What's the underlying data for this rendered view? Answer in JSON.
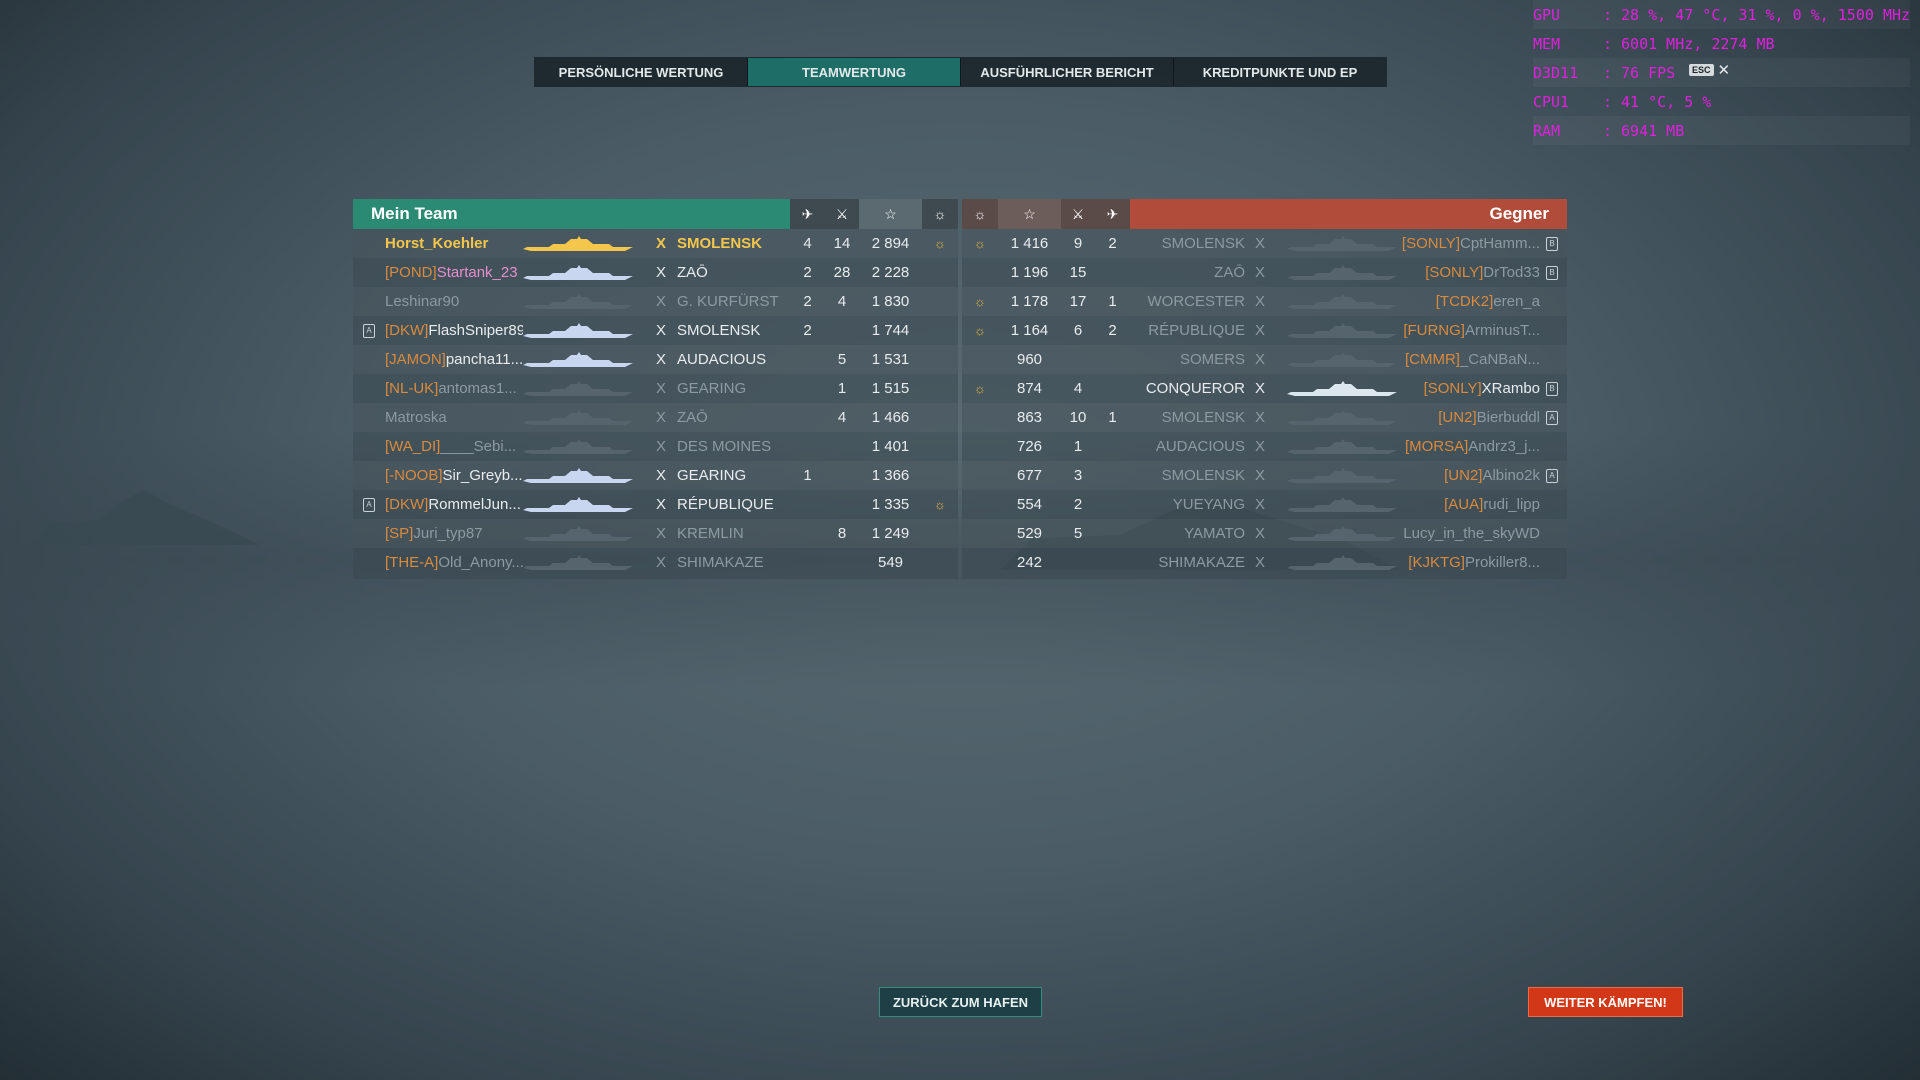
{
  "hud": [
    {
      "k": "GPU",
      "v": ": 28 %, 47 °C, 31 %, 0 %, 1500 MHz"
    },
    {
      "k": "MEM",
      "v": ": 6001 MHz, 2274 MB"
    },
    {
      "k": "D3D11",
      "v": ": 76 FPS"
    },
    {
      "k": "CPU1",
      "v": ": 41 °C, 5 %"
    },
    {
      "k": "RAM",
      "v": ": 6941 MB"
    }
  ],
  "tabs": [
    "PERSÖNLICHE WERTUNG",
    "TEAMWERTUNG",
    "AUSFÜHRLICHER BERICHT",
    "KREDITPUNKTE UND EP"
  ],
  "esc": {
    "key": "ESC",
    "close": "✕"
  },
  "my_team": {
    "title": "Mein Team",
    "rows": [
      {
        "clan": "",
        "name": "Horst_Koehler",
        "style": "me",
        "x": "X",
        "ship": "SMOLENSK",
        "planes": "4",
        "kills": "14",
        "exp": "2 894",
        "medal": true,
        "badge": ""
      },
      {
        "clan": "[POND]",
        "name": "Startank_23",
        "style": "pink",
        "x": "X",
        "ship": "ZAŌ",
        "planes": "2",
        "kills": "28",
        "exp": "2 228",
        "medal": false,
        "badge": ""
      },
      {
        "clan": "",
        "name": "Leshinar90",
        "style": "dim",
        "x": "X",
        "ship": "G. KURFÜRST",
        "planes": "2",
        "kills": "4",
        "exp": "1 830",
        "medal": false,
        "badge": ""
      },
      {
        "clan": "[DKW]",
        "name": "FlashSniper89",
        "style": "",
        "x": "X",
        "ship": "SMOLENSK",
        "planes": "2",
        "kills": "",
        "exp": "1 744",
        "medal": false,
        "badge": "A"
      },
      {
        "clan": "[JAMON]",
        "name": "pancha11...",
        "style": "",
        "x": "X",
        "ship": "AUDACIOUS",
        "planes": "",
        "kills": "5",
        "exp": "1 531",
        "medal": false,
        "badge": ""
      },
      {
        "clan": "[NL-UK]",
        "name": "antomas1...",
        "style": "dim",
        "x": "X",
        "ship": "GEARING",
        "planes": "",
        "kills": "1",
        "exp": "1 515",
        "medal": false,
        "badge": ""
      },
      {
        "clan": "",
        "name": "Matroska",
        "style": "dim",
        "x": "X",
        "ship": "ZAŌ",
        "planes": "",
        "kills": "4",
        "exp": "1 466",
        "medal": false,
        "badge": ""
      },
      {
        "clan": "[WA_DI]",
        "name": "____Sebi...",
        "style": "dim",
        "x": "X",
        "ship": "DES MOINES",
        "planes": "",
        "kills": "",
        "exp": "1 401",
        "medal": false,
        "badge": ""
      },
      {
        "clan": "[-NOOB]",
        "name": "Sir_Greyb...",
        "style": "",
        "x": "X",
        "ship": "GEARING",
        "planes": "1",
        "kills": "",
        "exp": "1 366",
        "medal": false,
        "badge": ""
      },
      {
        "clan": "[DKW]",
        "name": "RommelJun...",
        "style": "",
        "x": "X",
        "ship": "RÉPUBLIQUE",
        "planes": "",
        "kills": "",
        "exp": "1 335",
        "medal": true,
        "badge": "A"
      },
      {
        "clan": "[SP]",
        "name": "Juri_typ87",
        "style": "dim",
        "x": "X",
        "ship": "KREMLIN",
        "planes": "",
        "kills": "8",
        "exp": "1 249",
        "medal": false,
        "badge": ""
      },
      {
        "clan": "[THE-A]",
        "name": "Old_Anony...",
        "style": "dim",
        "x": "X",
        "ship": "SHIMAKAZE",
        "planes": "",
        "kills": "",
        "exp": "549",
        "medal": false,
        "badge": ""
      }
    ]
  },
  "enemy": {
    "title": "Gegner",
    "rows": [
      {
        "medal": true,
        "exp": "1 416",
        "kills": "9",
        "planes": "2",
        "ship": "SMOLENSK",
        "x": "X",
        "clan": "[SONLY]",
        "name": "CptHamm...",
        "style": "dim",
        "badge": "B"
      },
      {
        "medal": false,
        "exp": "1 196",
        "kills": "15",
        "planes": "",
        "ship": "ZAŌ",
        "x": "X",
        "clan": "[SONLY]",
        "name": "DrTod33",
        "style": "dim",
        "badge": "B"
      },
      {
        "medal": true,
        "exp": "1 178",
        "kills": "17",
        "planes": "1",
        "ship": "WORCESTER",
        "x": "X",
        "clan": "[TCDK2]",
        "name": "eren_a",
        "style": "dim",
        "badge": ""
      },
      {
        "medal": true,
        "exp": "1 164",
        "kills": "6",
        "planes": "2",
        "ship": "RÉPUBLIQUE",
        "x": "X",
        "clan": "[FURNG]",
        "name": "ArminusT...",
        "style": "dim",
        "badge": ""
      },
      {
        "medal": false,
        "exp": "960",
        "kills": "",
        "planes": "",
        "ship": "SOMERS",
        "x": "X",
        "clan": "[CMMR]",
        "name": "_CaNBaN...",
        "style": "dim",
        "badge": ""
      },
      {
        "medal": true,
        "exp": "874",
        "kills": "4",
        "planes": "",
        "ship": "CONQUEROR",
        "x": "X",
        "clan": "[SONLY]",
        "name": "XRambo",
        "style": "",
        "badge": "B"
      },
      {
        "medal": false,
        "exp": "863",
        "kills": "10",
        "planes": "1",
        "ship": "SMOLENSK",
        "x": "X",
        "clan": "[UN2]",
        "name": "Bierbuddl",
        "style": "dim",
        "badge": "A"
      },
      {
        "medal": false,
        "exp": "726",
        "kills": "1",
        "planes": "",
        "ship": "AUDACIOUS",
        "x": "X",
        "clan": "[MORSA]",
        "name": "Andrz3_j...",
        "style": "dim",
        "badge": ""
      },
      {
        "medal": false,
        "exp": "677",
        "kills": "3",
        "planes": "",
        "ship": "SMOLENSK",
        "x": "X",
        "clan": "[UN2]",
        "name": "Albino2k",
        "style": "dim",
        "badge": "A"
      },
      {
        "medal": false,
        "exp": "554",
        "kills": "2",
        "planes": "",
        "ship": "YUEYANG",
        "x": "X",
        "clan": "[AUA]",
        "name": "rudi_lipp",
        "style": "dim",
        "badge": ""
      },
      {
        "medal": false,
        "exp": "529",
        "kills": "5",
        "planes": "",
        "ship": "YAMATO",
        "x": "X",
        "clan": "",
        "name": "Lucy_in_the_skyWD",
        "style": "dim",
        "badge": ""
      },
      {
        "medal": false,
        "exp": "242",
        "kills": "",
        "planes": "",
        "ship": "SHIMAKAZE",
        "x": "X",
        "clan": "[KJKTG]",
        "name": "Prokiller8...",
        "style": "dim",
        "badge": ""
      }
    ]
  },
  "buttons": {
    "home": "ZURÜCK ZUM HAFEN",
    "fight": "WEITER KÄMPFEN!"
  },
  "icons": {
    "planes": "plane-icon",
    "kills": "kills-icon",
    "exp": "star-icon",
    "medal": "medal-icon"
  }
}
